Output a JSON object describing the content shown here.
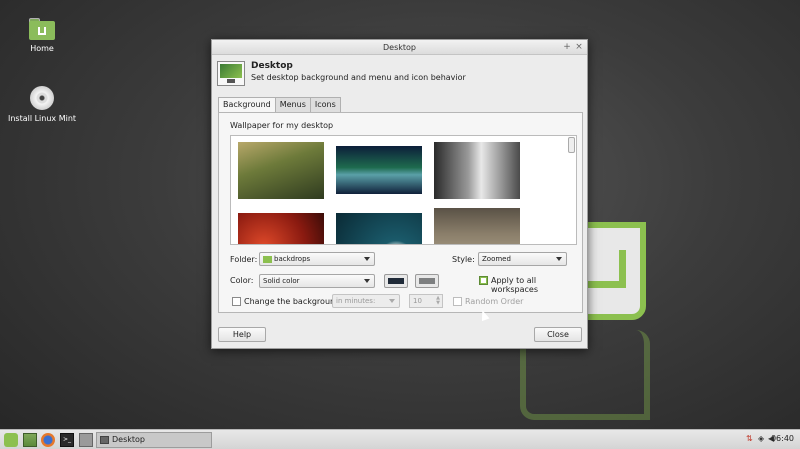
{
  "desktop": {
    "icons": [
      {
        "label": "Home",
        "icon": "home-folder-icon"
      },
      {
        "label": "Install Linux Mint",
        "icon": "disc-icon"
      }
    ]
  },
  "dialog": {
    "title": "Desktop",
    "header_title": "Desktop",
    "header_subtitle": "Set desktop background and menu and icon behavior",
    "tabs": [
      "Background",
      "Menus",
      "Icons"
    ],
    "active_tab": "Background",
    "wallpaper_label": "Wallpaper for my desktop",
    "folder_label": "Folder:",
    "folder_value": "backdrops",
    "style_label": "Style:",
    "style_value": "Zoomed",
    "color_label": "Color:",
    "color_value": "Solid color",
    "color1": "#1f2a38",
    "color2": "#7d7f80",
    "apply_all_label": "Apply to all workspaces",
    "apply_all_checked": true,
    "change_bg_label": "Change the background",
    "change_bg_checked": false,
    "interval_value": "in minutes:",
    "minutes_value": "10",
    "random_order_label": "Random Order",
    "help_button": "Help",
    "close_button": "Close",
    "title_buttons": [
      "+",
      "×"
    ]
  },
  "taskbar": {
    "launchers": [
      "mint-menu-icon",
      "file-manager-icon",
      "firefox-icon",
      "terminal-icon",
      "show-desktop-icon"
    ],
    "task_label": "Desktop",
    "clock": "06:40",
    "accent": "#8cc04f"
  }
}
